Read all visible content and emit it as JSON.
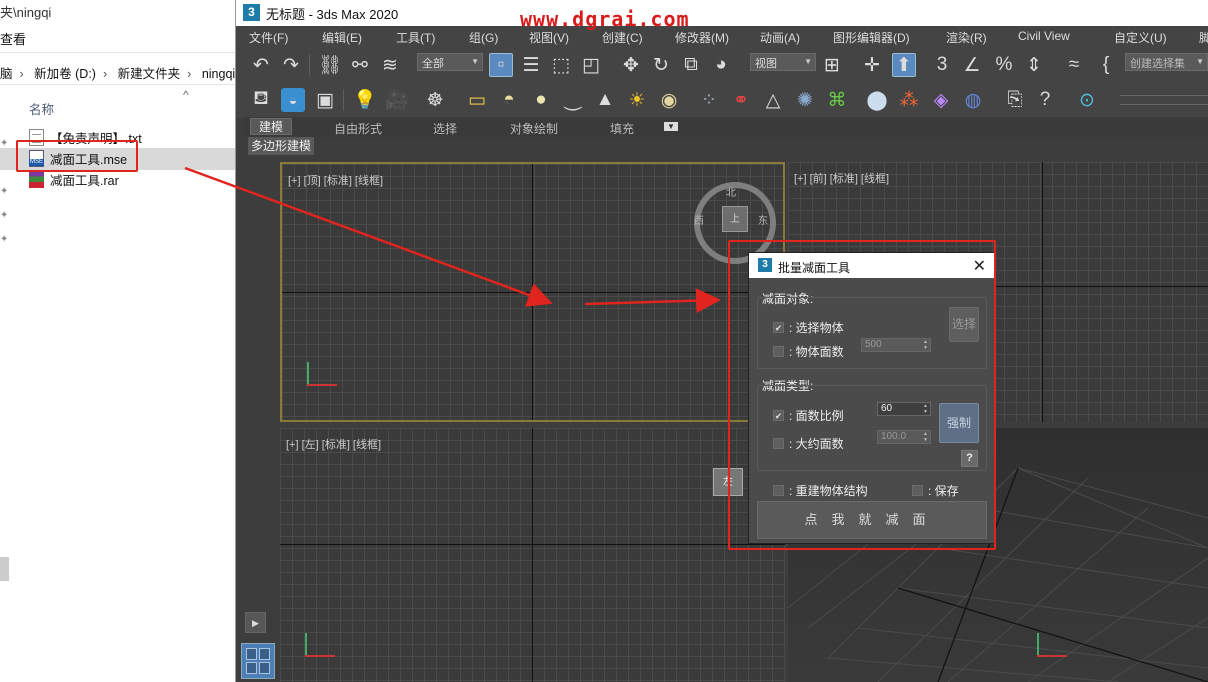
{
  "explorer": {
    "path_fragment": "夹\\ningqi",
    "view_menu": "查看",
    "breadcrumb": [
      "脑",
      "新加卷 (D:)",
      "新建文件夹",
      "ningqi"
    ],
    "column_name": "名称",
    "files": [
      {
        "name": "【免责声明】.txt",
        "icon": "text-file-icon"
      },
      {
        "name": "减面工具.mse",
        "icon": "mse-file-icon"
      },
      {
        "name": "减面工具.rar",
        "icon": "rar-archive-icon"
      }
    ]
  },
  "max": {
    "title": "无标题 - 3ds Max 2020",
    "watermark": "www.dgrai.com",
    "menu": [
      "文件(F)",
      "编辑(E)",
      "工具(T)",
      "组(G)",
      "视图(V)",
      "创建(C)",
      "修改器(M)",
      "动画(A)",
      "图形编辑器(D)",
      "渲染(R)",
      "Civil View",
      "自定义(U)",
      "脚"
    ],
    "filter_dropdown": "全部",
    "view_dropdown": "视图",
    "selection_set": "创建选择集",
    "ribbon_tabs": [
      "建模",
      "自由形式",
      "选择",
      "对象绘制",
      "填充"
    ],
    "ribbon_subtab": "多边形建模",
    "viewports": {
      "top": "[+] [顶] [标准] [线框]",
      "front": "[+] [前] [标准] [线框]",
      "left": "[+] [左] [标准] [线框]"
    },
    "viewcube": {
      "top": "上",
      "north": "北",
      "west": "西",
      "east": "东",
      "south": "南",
      "left": "左"
    }
  },
  "dialog": {
    "title": "批量减面工具",
    "group1_label": "减面对象:",
    "select_objects": "选择物体",
    "object_face_count": "物体面数",
    "face_count_value": "500",
    "select_button": "选择",
    "group2_label": "减面类型:",
    "face_ratio": "面数比例",
    "face_ratio_value": "60",
    "approx_faces": "大约面数",
    "approx_faces_value": "100.0",
    "force_button": "强制",
    "help_button": "?",
    "rebuild_structure": "重建物体结构",
    "keep": "保存",
    "go_button": "点我就减面"
  }
}
